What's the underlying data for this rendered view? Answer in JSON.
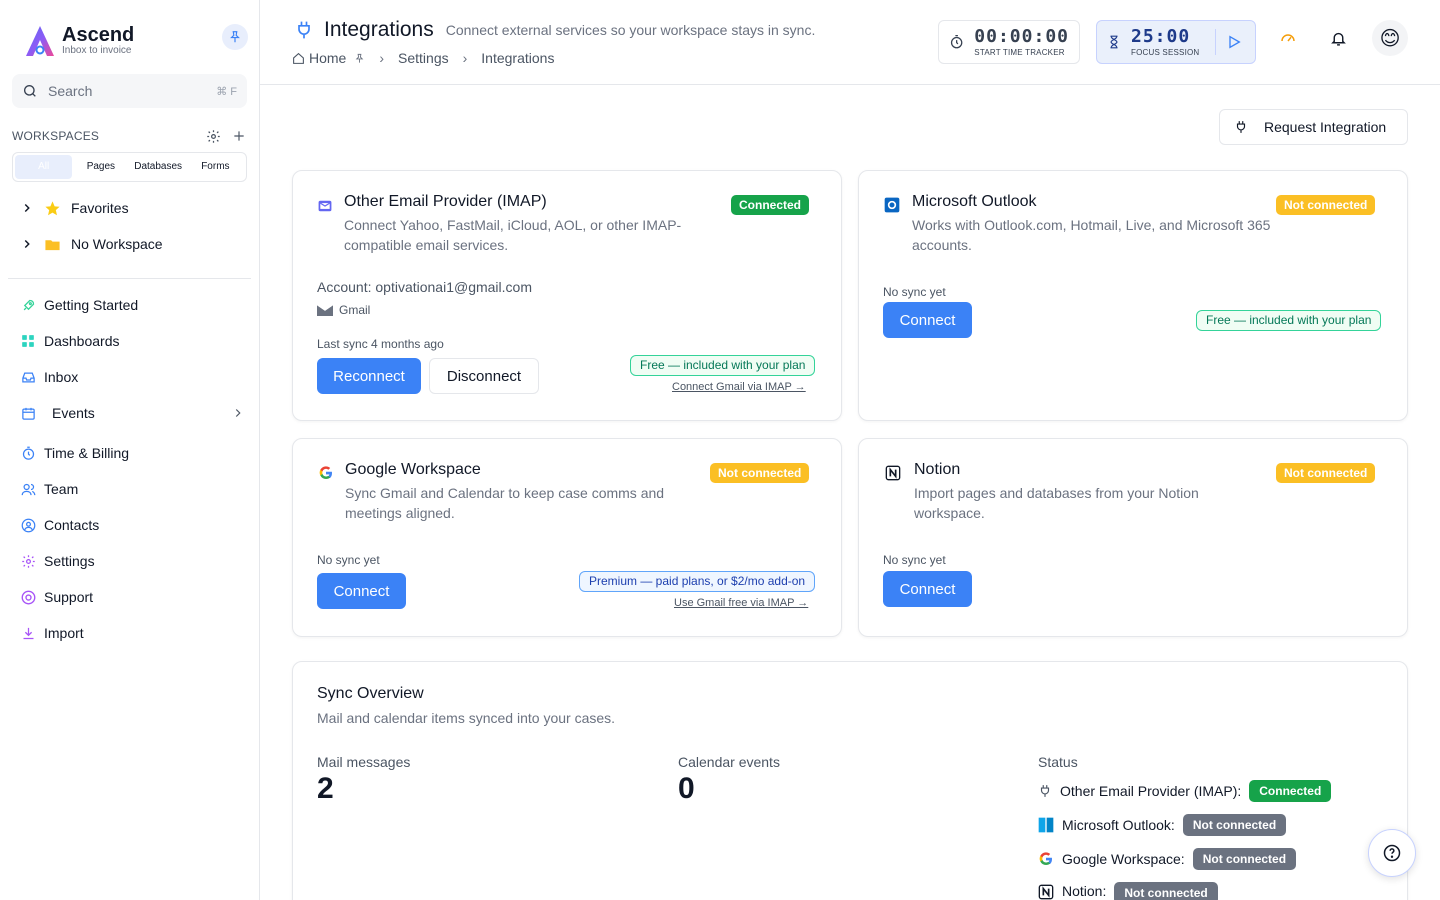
{
  "brand": {
    "name": "Ascend",
    "tagline": "Inbox to invoice"
  },
  "search": {
    "placeholder": "Search",
    "shortcut": "⌘ F"
  },
  "workspaces": {
    "title": "WORKSPACES",
    "tabs": [
      "All",
      "Pages",
      "Databases",
      "Forms"
    ],
    "tree": [
      {
        "label": "Favorites"
      },
      {
        "label": "No Workspace"
      }
    ]
  },
  "nav": [
    {
      "label": "Getting Started",
      "icon": "rocket-icon"
    },
    {
      "label": "Dashboards",
      "icon": "grid-icon"
    },
    {
      "label": "Inbox",
      "icon": "inbox-icon"
    },
    {
      "label": "Events",
      "icon": "calendar-icon"
    },
    {
      "label": "Time & Billing",
      "icon": "stopwatch-icon"
    },
    {
      "label": "Team",
      "icon": "team-icon"
    },
    {
      "label": "Contacts",
      "icon": "contact-icon"
    },
    {
      "label": "Settings",
      "icon": "gear-icon"
    },
    {
      "label": "Support",
      "icon": "lifebuoy-icon"
    },
    {
      "label": "Import",
      "icon": "download-icon"
    }
  ],
  "header": {
    "title": "Integrations",
    "subtitle": "Connect external services so your workspace stays in sync.",
    "breadcrumb": [
      "Home",
      "Settings",
      "Integrations"
    ]
  },
  "timers": {
    "tracker": {
      "value": "00:00:00",
      "label": "START TIME TRACKER"
    },
    "focus": {
      "value": "25:00",
      "label": "FOCUS SESSION"
    }
  },
  "avatar": "😊",
  "actions": {
    "request_integration": "Request Integration"
  },
  "cards": {
    "imap": {
      "title": "Other Email Provider (IMAP)",
      "status": "Connected",
      "desc": "Connect Yahoo, FastMail, iCloud, AOL, or other IMAP-compatible email services.",
      "account": "Account: optivationai1@gmail.com",
      "provider": "Gmail",
      "last_sync": "Last sync 4 months ago",
      "primary": "Reconnect",
      "secondary": "Disconnect",
      "pill": "Free — included with your plan",
      "link": "Connect Gmail via IMAP →"
    },
    "outlook": {
      "title": "Microsoft Outlook",
      "status": "Not connected",
      "desc": "Works with Outlook.com, Hotmail, Live, and Microsoft 365 accounts.",
      "sync": "No sync yet",
      "primary": "Connect",
      "pill": "Free — included with your plan"
    },
    "google": {
      "title": "Google Workspace",
      "status": "Not connected",
      "desc": "Sync Gmail and Calendar to keep case comms and meetings aligned.",
      "sync": "No sync yet",
      "primary": "Connect",
      "pill": "Premium — paid plans, or $2/mo add-on",
      "link": "Use Gmail free via IMAP →"
    },
    "notion": {
      "title": "Notion",
      "status": "Not connected",
      "desc": "Import pages and databases from your Notion workspace.",
      "sync": "No sync yet",
      "primary": "Connect"
    }
  },
  "sync_overview": {
    "title": "Sync Overview",
    "desc": "Mail and calendar items synced into your cases.",
    "mail_label": "Mail messages",
    "mail_value": "2",
    "calendar_label": "Calendar events",
    "calendar_value": "0",
    "status_label": "Status",
    "statuses": [
      {
        "name": "Other Email Provider (IMAP):",
        "state": "Connected"
      },
      {
        "name": "Microsoft Outlook:",
        "state": "Not connected"
      },
      {
        "name": "Google Workspace:",
        "state": "Not connected"
      },
      {
        "name": "Notion:",
        "state": "Not connected"
      }
    ]
  },
  "colors": {
    "accent": "#3b82f6",
    "success": "#16a34a",
    "warning": "#fbbf24",
    "muted": "#6b7280"
  }
}
